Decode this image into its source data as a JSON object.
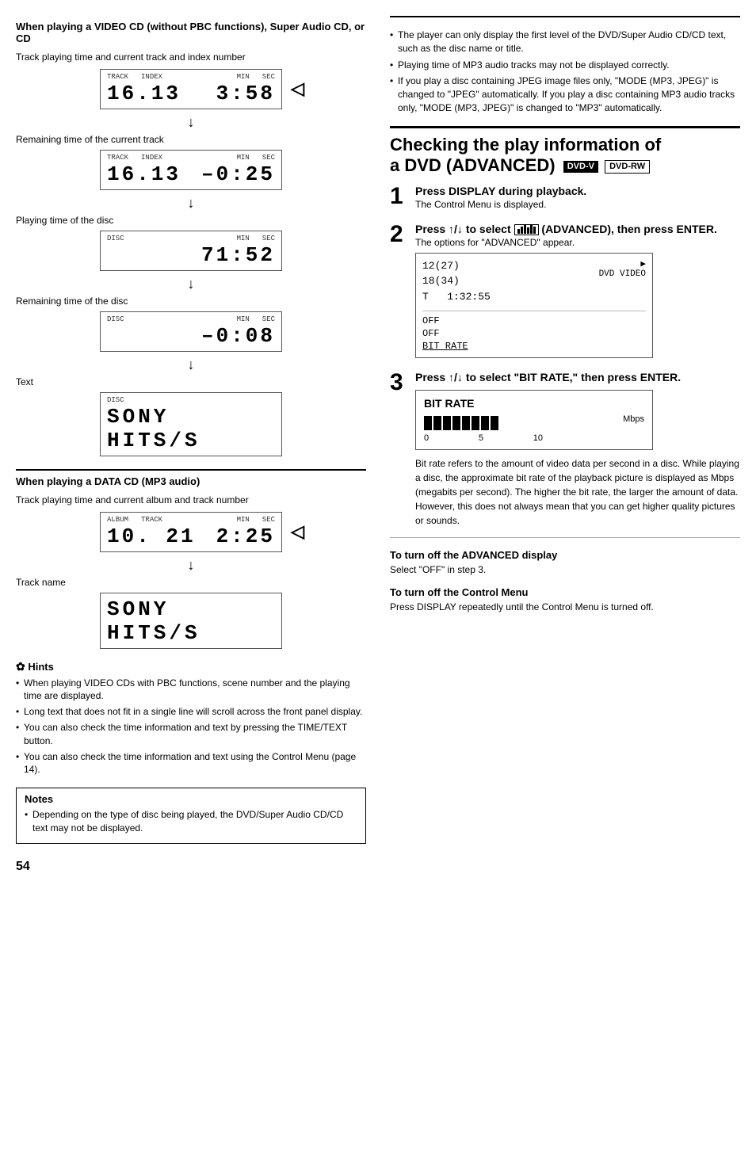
{
  "left": {
    "section1": {
      "heading": "When playing a VIDEO CD (without PBC functions), Super Audio CD, or CD",
      "caption1": "Track playing time and current track and index number",
      "display1": {
        "labels": [
          "TRACK",
          "INDEX",
          "MIN",
          "SEC"
        ],
        "value_left": "16.13",
        "value_right": "3:58"
      },
      "label_remaining": "Remaining time of the current track",
      "display2": {
        "labels": [
          "TRACK",
          "INDEX",
          "MIN",
          "SEC"
        ],
        "value_left": "16.13",
        "value_right": "–0:25"
      },
      "label_playing": "Playing time of the disc",
      "display3": {
        "labels": [
          "DISC",
          "",
          "MIN",
          "SEC"
        ],
        "value_left": "",
        "value_right": "71:52"
      },
      "label_remaining2": "Remaining time of the disc",
      "display4": {
        "labels": [
          "DISC",
          "",
          "MIN",
          "SEC"
        ],
        "value_left": "",
        "value_right": "–0:08"
      },
      "label_text": "Text",
      "display5": {
        "value": "SONY HITS/S"
      }
    },
    "section2": {
      "heading": "When playing a DATA CD (MP3 audio)",
      "caption1": "Track playing time and current album and track number",
      "display1": {
        "labels": [
          "ALBUM",
          "TRACK",
          "MIN",
          "SEC"
        ],
        "value_left": "10. 21",
        "value_right": "2:25"
      },
      "label_track": "Track name",
      "display2": {
        "value": "SONY HITS/S"
      }
    },
    "hints": {
      "icon": "✿",
      "title": "Hints",
      "items": [
        "When playing VIDEO CDs with PBC functions, scene number and the playing time are displayed.",
        "Long text that does not fit in a single line will scroll across the front panel display.",
        "You can also check the time information and text by pressing the TIME/TEXT button.",
        "You can also check the time information and text using the Control Menu (page 14)."
      ]
    },
    "notes": {
      "title": "Notes",
      "items": [
        "Depending on the type of disc being played, the DVD/Super Audio CD/CD text may not be displayed."
      ]
    }
  },
  "right": {
    "notes_top": {
      "items": [
        "The player can only display the first level of the DVD/Super Audio CD/CD text, such as the disc name or title.",
        "Playing time of MP3 audio tracks may not be displayed correctly.",
        "If you play a disc containing JPEG image files only, \"MODE (MP3, JPEG)\" is changed to \"JPEG\" automatically. If you play a disc containing MP3 audio tracks only, \"MODE (MP3, JPEG)\" is changed to \"MP3\" automatically."
      ]
    },
    "advanced": {
      "heading": "Checking the play information of a DVD (ADVANCED)",
      "badge1": "DVD-V",
      "badge2": "DVD-RW",
      "steps": [
        {
          "num": "1",
          "title": "Press DISPLAY during playback.",
          "desc": "The Control Menu is displayed."
        },
        {
          "num": "2",
          "title": "Press ↑/↓ to select (ADVANCED), then press ENTER.",
          "desc": "The options for \"ADVANCED\" appear.",
          "panel": {
            "time_lines": [
              "12(27)",
              "18(34)",
              "T   1:32:55"
            ],
            "right_label": "DVD VIDEO",
            "options": [
              "OFF",
              "OFF",
              "BIT RATE"
            ],
            "selected": "BIT RATE"
          }
        },
        {
          "num": "3",
          "title": "Press ↑/↓ to select \"BIT RATE,\" then press ENTER.",
          "panel": {
            "title": "BIT RATE",
            "bars": 8,
            "scale": [
              "0",
              "5",
              "10"
            ],
            "unit": "Mbps"
          }
        }
      ],
      "bitrate_desc": "Bit rate refers to the amount of video data per second in a disc. While playing a disc, the approximate bit rate of the playback picture is displayed as Mbps (megabits per second). The higher the bit rate, the larger the amount of data. However, this does not always mean that you can get higher quality pictures or sounds.",
      "turn_off_advanced": {
        "heading": "To turn off the ADVANCED display",
        "desc": "Select \"OFF\" in step 3."
      },
      "turn_off_control": {
        "heading": "To turn off the Control Menu",
        "desc": "Press DISPLAY repeatedly until the Control Menu is turned off."
      }
    }
  },
  "page_num": "54"
}
